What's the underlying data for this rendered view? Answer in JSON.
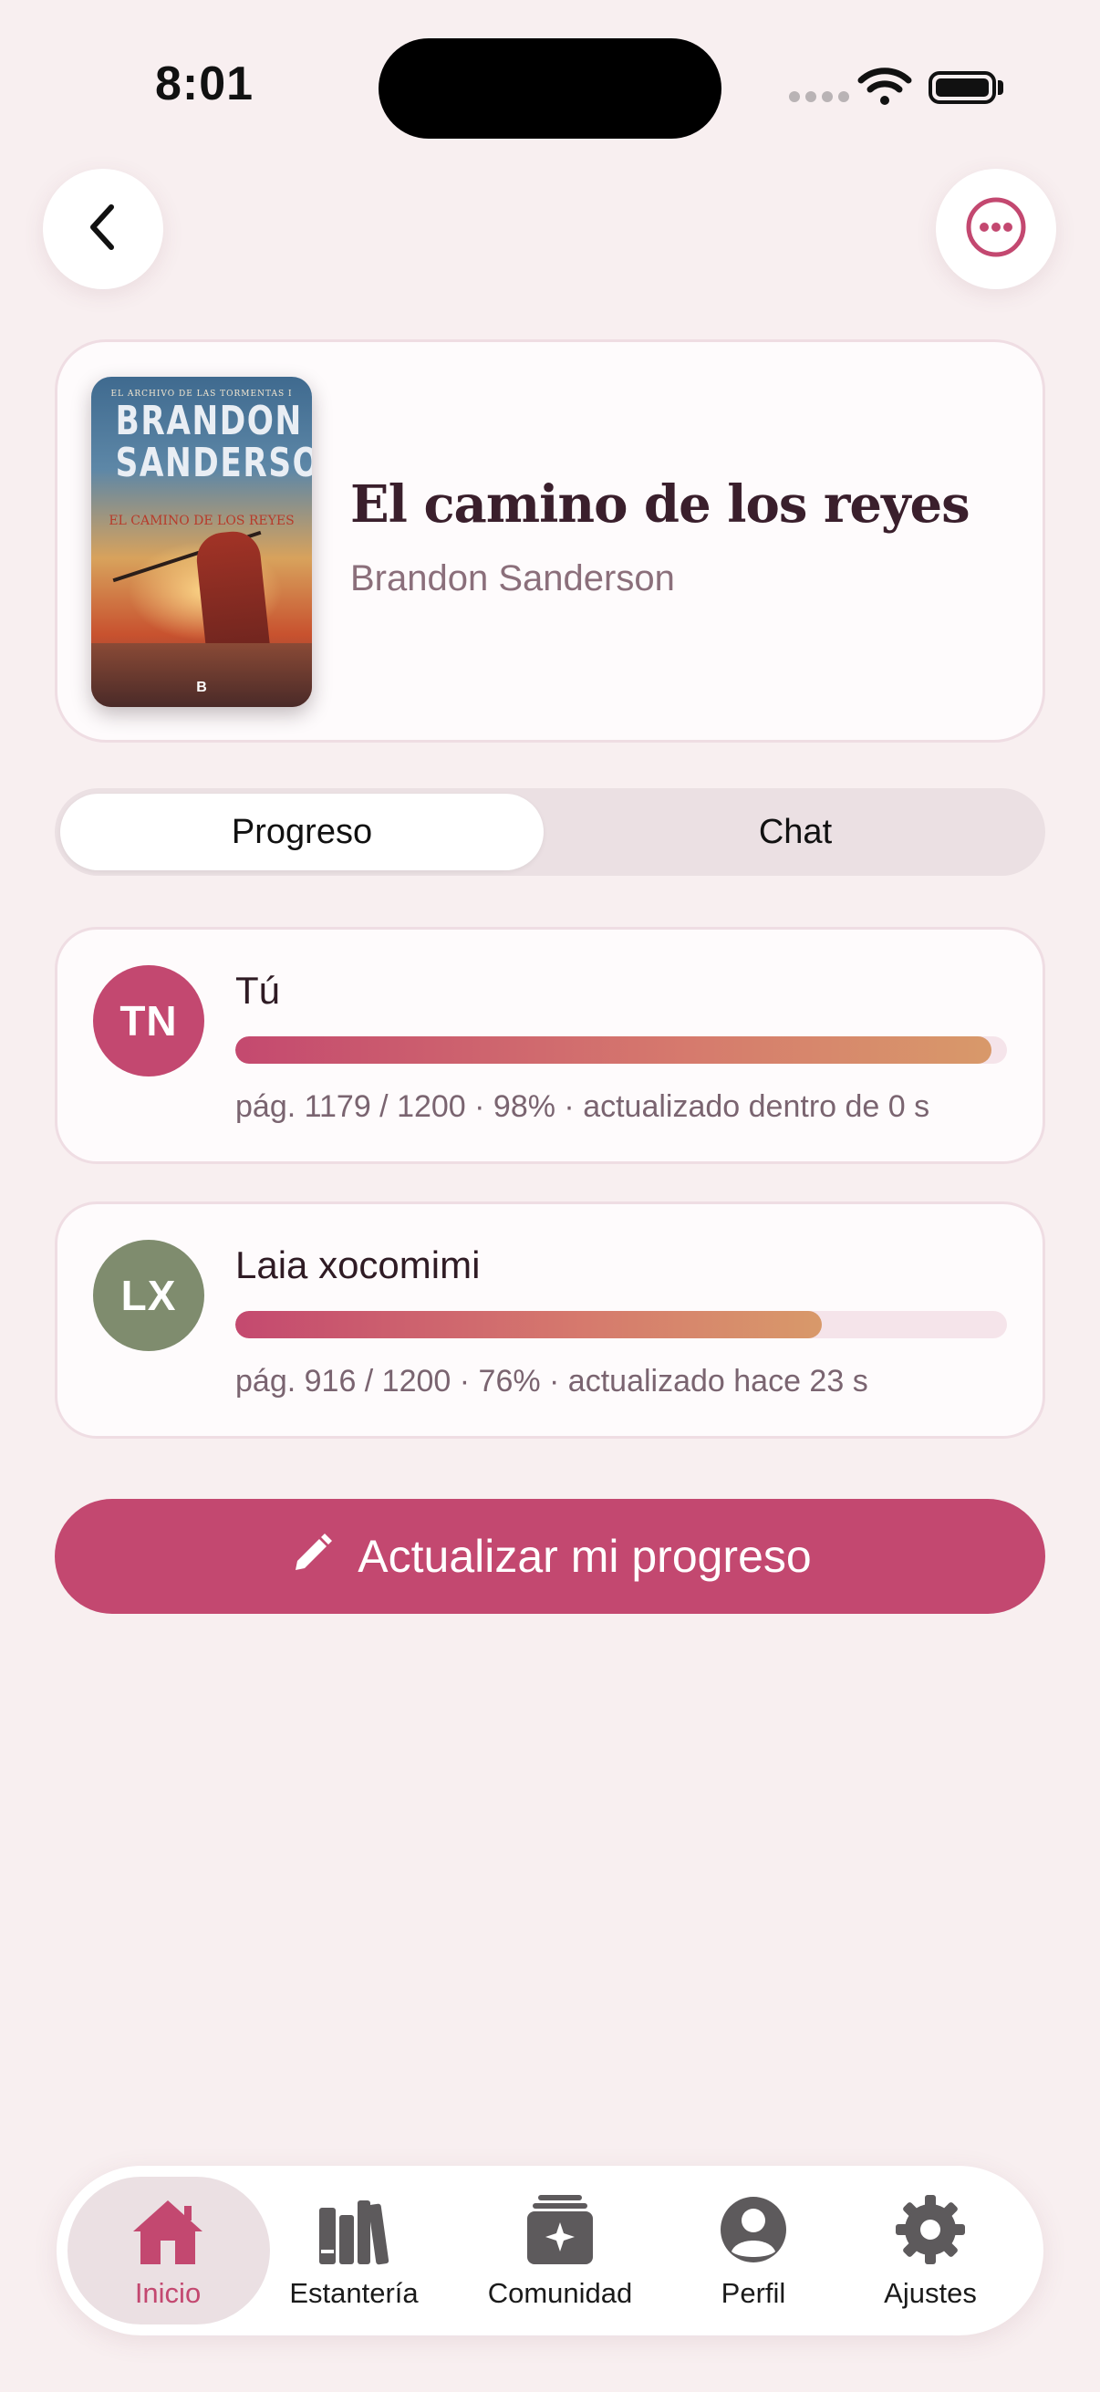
{
  "status_bar": {
    "time": "8:01"
  },
  "book": {
    "title": "El camino de los reyes",
    "author": "Brandon Sanderson",
    "cover": {
      "series": "EL ARCHIVO DE LAS TORMENTAS I",
      "author_line1": "BRANDON",
      "author_line2": "SANDERSON",
      "title": "EL CAMINO DE LOS REYES",
      "publisher": "B"
    }
  },
  "tabs": {
    "progreso": "Progreso",
    "chat": "Chat",
    "selected": "Progreso"
  },
  "readers": [
    {
      "initials": "TN",
      "name": "Tú",
      "avatar_color": "#c34870",
      "progress": 0.98,
      "meta": "pág. 1179 / 1200 · 98% · actualizado dentro de 0 s"
    },
    {
      "initials": "LX",
      "name": "Laia xocomimi",
      "avatar_color": "#7f8c6e",
      "progress": 0.76,
      "meta": "pág. 916 / 1200 · 76% · actualizado hace 23 s"
    }
  ],
  "actions": {
    "update_progress": "Actualizar mi progreso"
  },
  "tab_bar": {
    "items": [
      {
        "label": "Inicio",
        "icon": "home-icon",
        "active": true
      },
      {
        "label": "Estantería",
        "icon": "books-icon"
      },
      {
        "label": "Comunidad",
        "icon": "community-icon"
      },
      {
        "label": "Perfil",
        "icon": "person-icon"
      },
      {
        "label": "Ajustes",
        "icon": "gear-icon"
      }
    ]
  },
  "colors": {
    "accent": "#c34870",
    "background": "#f8eff0"
  }
}
